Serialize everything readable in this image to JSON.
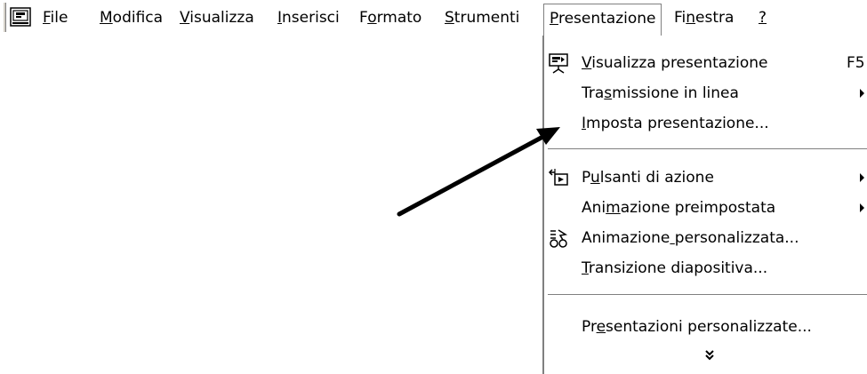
{
  "menubar": {
    "items": [
      {
        "label": "File",
        "mnemonic_index": 0
      },
      {
        "label": "Modifica",
        "mnemonic_index": 0
      },
      {
        "label": "Visualizza",
        "mnemonic_index": 0
      },
      {
        "label": "Inserisci",
        "mnemonic_index": 0
      },
      {
        "label": "Formato",
        "mnemonic_index": 1
      },
      {
        "label": "Strumenti",
        "mnemonic_index": 0
      },
      {
        "label": "Presentazione",
        "mnemonic_index": 0
      },
      {
        "label": "Finestra",
        "mnemonic_index": 2
      },
      {
        "label": "?",
        "mnemonic_index": 0
      }
    ],
    "active_item": "Presentazione"
  },
  "dropdown": {
    "items": [
      {
        "label": "Visualizza presentazione",
        "mnemonic_index": 0,
        "shortcut": "F5",
        "icon": "slideshow-icon",
        "submenu": false
      },
      {
        "label": "Trasmissione in linea",
        "mnemonic_index": 3,
        "shortcut": "",
        "icon": "",
        "submenu": true
      },
      {
        "label": "Imposta presentazione...",
        "mnemonic_index": 0,
        "shortcut": "",
        "icon": "",
        "submenu": false
      },
      {
        "label": "Pulsanti di azione",
        "mnemonic_index": 1,
        "shortcut": "",
        "icon": "action-buttons-icon",
        "submenu": true
      },
      {
        "label": "Animazione preimpostata",
        "mnemonic_index": 3,
        "shortcut": "",
        "icon": "",
        "submenu": true
      },
      {
        "label": "Animazione personalizzata...",
        "mnemonic_index": 10,
        "shortcut": "",
        "icon": "custom-animation-icon",
        "submenu": false
      },
      {
        "label": "Transizione diapositiva...",
        "mnemonic_index": 0,
        "shortcut": "",
        "icon": "",
        "submenu": false
      },
      {
        "label": "Presentazioni personalizzate...",
        "mnemonic_index": 2,
        "shortcut": "",
        "icon": "",
        "submenu": false
      }
    ],
    "expand_glyph": "chevron-double-down-icon",
    "expand_text": "»"
  },
  "colors": {
    "background": "#ffffff",
    "menu_border": "#808080",
    "text": "#000000"
  }
}
